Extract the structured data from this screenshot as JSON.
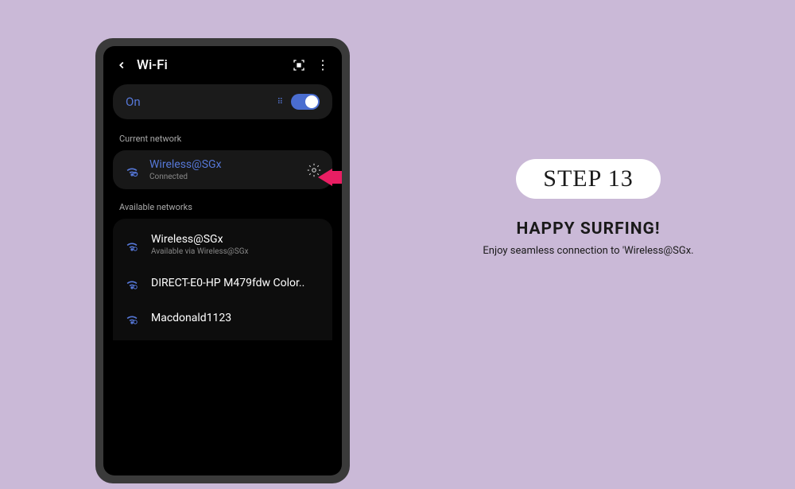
{
  "colors": {
    "accent": "#5678d8",
    "arrow": "#e91e63"
  },
  "header": {
    "title": "Wi-Fi"
  },
  "toggle": {
    "label": "On",
    "state": true
  },
  "current": {
    "section_label": "Current network",
    "name": "Wireless@SGx",
    "status": "Connected"
  },
  "available": {
    "section_label": "Available networks",
    "items": [
      {
        "name": "Wireless@SGx",
        "sub": "Available via Wireless@SGx"
      },
      {
        "name": "DIRECT-E0-HP M479fdw Color..",
        "sub": ""
      },
      {
        "name": "Macdonald1123",
        "sub": ""
      }
    ]
  },
  "instruction": {
    "step_label": "STEP 13",
    "title": "HAPPY SURFING!",
    "subtitle": "Enjoy seamless connection to 'Wireless@SGx."
  }
}
